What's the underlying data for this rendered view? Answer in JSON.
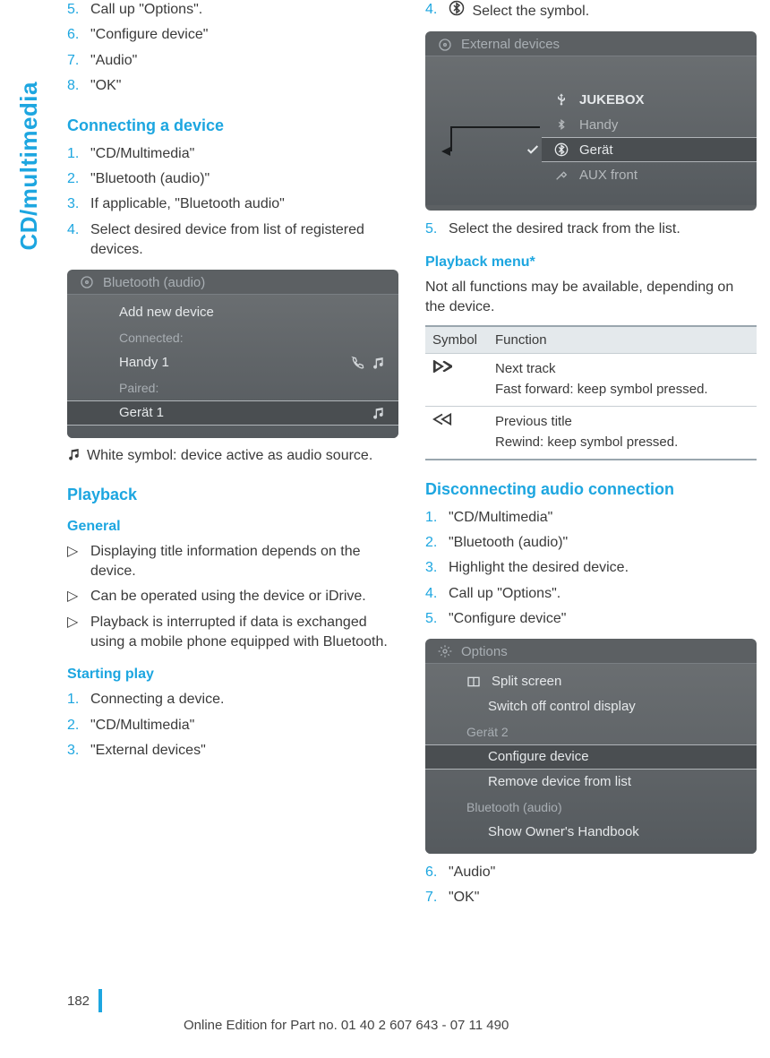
{
  "side_tab": "CD/multimedia",
  "col1": {
    "steps_top": [
      {
        "n": "5.",
        "t": "Call up \"Options\"."
      },
      {
        "n": "6.",
        "t": "\"Configure device\""
      },
      {
        "n": "7.",
        "t": "\"Audio\""
      },
      {
        "n": "8.",
        "t": "\"OK\""
      }
    ],
    "h_connecting": "Connecting a device",
    "steps_connecting": [
      {
        "n": "1.",
        "t": "\"CD/Multimedia\""
      },
      {
        "n": "2.",
        "t": "\"Bluetooth (audio)\""
      },
      {
        "n": "3.",
        "t": "If applicable, \"Bluetooth audio\""
      },
      {
        "n": "4.",
        "t": "Select desired device from list of registered devices."
      }
    ],
    "fig1": {
      "title": "Bluetooth (audio)",
      "rows": {
        "add": "Add new device",
        "connected": "Connected:",
        "handy": "Handy 1",
        "paired": "Paired:",
        "gerat": "Gerät 1"
      }
    },
    "note_white": "White symbol: device active as audio source.",
    "h_playback": "Playback",
    "h_general": "General",
    "bullets_general": [
      "Displaying title information depends on the device.",
      "Can be operated using the device or iDrive.",
      "Playback is interrupted if data is exchanged using a mobile phone equipped with Blue­tooth."
    ],
    "h_starting": "Starting play",
    "steps_starting": [
      {
        "n": "1.",
        "t": "Connecting a device."
      },
      {
        "n": "2.",
        "t": "\"CD/Multimedia\""
      },
      {
        "n": "3.",
        "t": "\"External devices\""
      }
    ]
  },
  "col2": {
    "steps_top": [
      {
        "n": "4.",
        "t": " Select the symbol."
      }
    ],
    "fig2": {
      "title": "External devices",
      "rows": {
        "jukebox": "JUKEBOX",
        "handy": "Handy",
        "gerat": "Gerät",
        "aux": "AUX front"
      }
    },
    "step5": {
      "n": "5.",
      "t": "Select the desired track from the list."
    },
    "h_playback_menu": "Playback menu*",
    "p_playback_menu": "Not all functions may be available, depending on the device.",
    "tbl": {
      "head": {
        "c1": "Symbol",
        "c2": "Function"
      },
      "rows": [
        {
          "a": "Next track",
          "b": "Fast forward: keep symbol pressed."
        },
        {
          "a": "Previous title",
          "b": "Rewind: keep symbol pressed."
        }
      ]
    },
    "h_disconnect": "Disconnecting audio connection",
    "steps_disconnect": [
      {
        "n": "1.",
        "t": "\"CD/Multimedia\""
      },
      {
        "n": "2.",
        "t": "\"Bluetooth (audio)\""
      },
      {
        "n": "3.",
        "t": "Highlight the desired device."
      },
      {
        "n": "4.",
        "t": "Call up \"Options\"."
      },
      {
        "n": "5.",
        "t": "\"Configure device\""
      }
    ],
    "fig3": {
      "title": "Options",
      "rows": {
        "split": "Split screen",
        "switchoff": "Switch off control display",
        "gerat2": "Gerät 2",
        "configure": "Configure device",
        "remove": "Remove device from list",
        "bt": "Bluetooth (audio)",
        "show": "Show Owner's Handbook"
      }
    },
    "steps_after_fig3": [
      {
        "n": "6.",
        "t": "\"Audio\""
      },
      {
        "n": "7.",
        "t": "\"OK\""
      }
    ]
  },
  "footer": {
    "page": "182",
    "line": "Online Edition for Part no. 01 40 2 607 643 - 07 11 490"
  }
}
